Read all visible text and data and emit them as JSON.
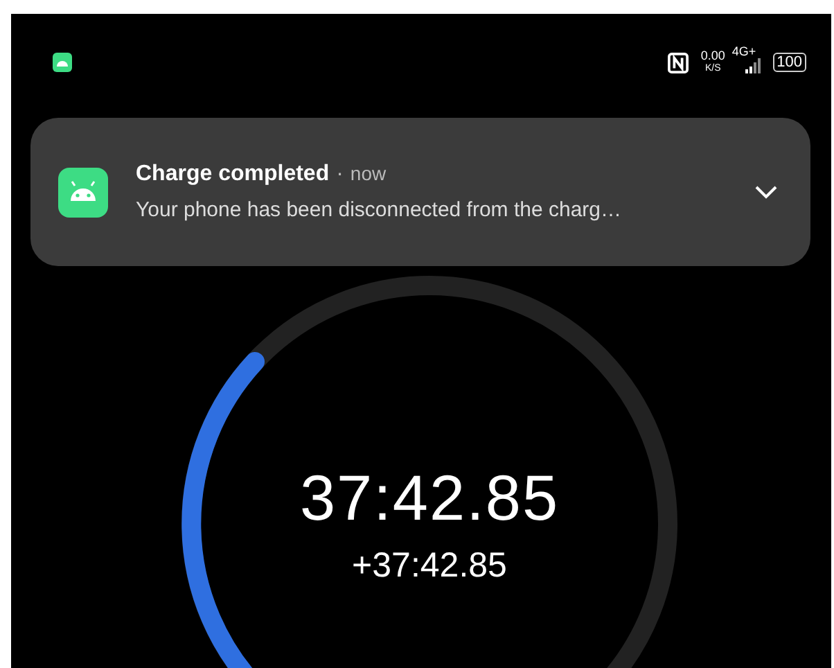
{
  "status_bar": {
    "speed": "0.00",
    "speed_unit": "K/S",
    "network": "4G+",
    "battery": "100"
  },
  "notification": {
    "title": "Charge completed",
    "separator": "·",
    "time": "now",
    "body": "Your phone has been disconnected from the charg…",
    "expanded": false
  },
  "stopwatch": {
    "time": "37:42.85",
    "lap": "+37:42.85"
  }
}
